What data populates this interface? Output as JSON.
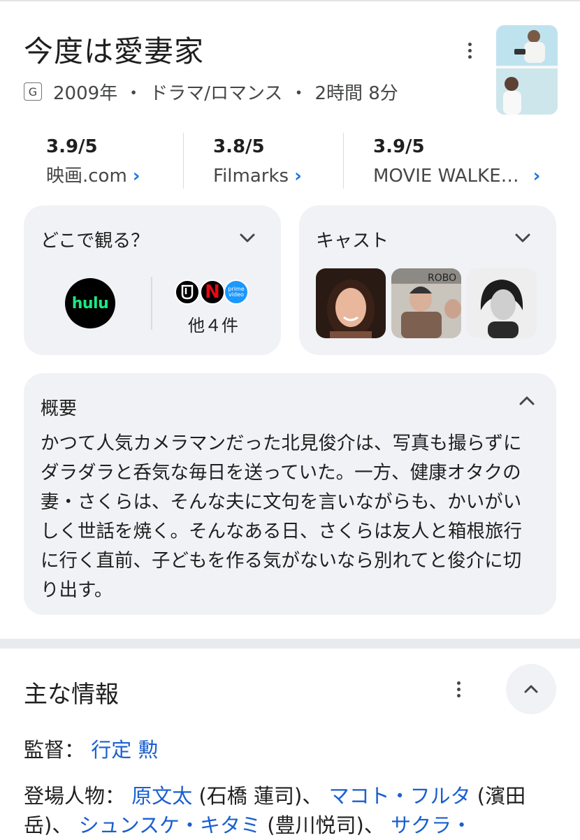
{
  "header": {
    "title": "今度は愛妻家",
    "rating_badge": "G",
    "year": "2009年",
    "genre": "ドラマ/ロマンス",
    "runtime": "2時間 8分",
    "separator": "・"
  },
  "ratings": [
    {
      "score": "3.9/5",
      "source": "映画.com"
    },
    {
      "score": "3.8/5",
      "source": "Filmarks"
    },
    {
      "score": "3.9/5",
      "source": "MOVIE WALKE…"
    }
  ],
  "where_to_watch": {
    "title": "どこで観る？",
    "provider": "hulu",
    "more": "他４件",
    "icons": [
      "u-next-icon",
      "netflix-icon",
      "prime-video-icon"
    ]
  },
  "cast_card": {
    "title": "キャスト"
  },
  "summary": {
    "title": "概要",
    "text": "かつて人気カメラマンだった北見俊介は、写真も撮らずにダラダラと呑気な毎日を送っていた。一方、健康オタクの妻・さくらは、そんな夫に文句を言いながらも、かいがいしく世話を焼く。そんなある日、さくらは友人と箱根旅行に行く直前、子どもを作る気がないなら別れてと俊介に切り出す。"
  },
  "main_info": {
    "title": "主な情報",
    "director_label": "監督：",
    "director": "行定 勲",
    "characters_label": "登場人物：",
    "characters": [
      {
        "name": "原文太",
        "actor": "(石橋 蓮司)"
      },
      {
        "name": "マコト・フルタ",
        "actor": "(濱田 岳)"
      },
      {
        "name": "シュンスケ・キタミ",
        "actor": "(豊川悦司)"
      },
      {
        "name": "サクラ・",
        "actor": ""
      }
    ],
    "list_separator": "、"
  },
  "colors": {
    "link": "#1a5fd0",
    "card_bg": "#f0f2f5",
    "hulu_green": "#1ce783",
    "netflix_red": "#e50914",
    "prime_blue": "#1a98ff"
  }
}
